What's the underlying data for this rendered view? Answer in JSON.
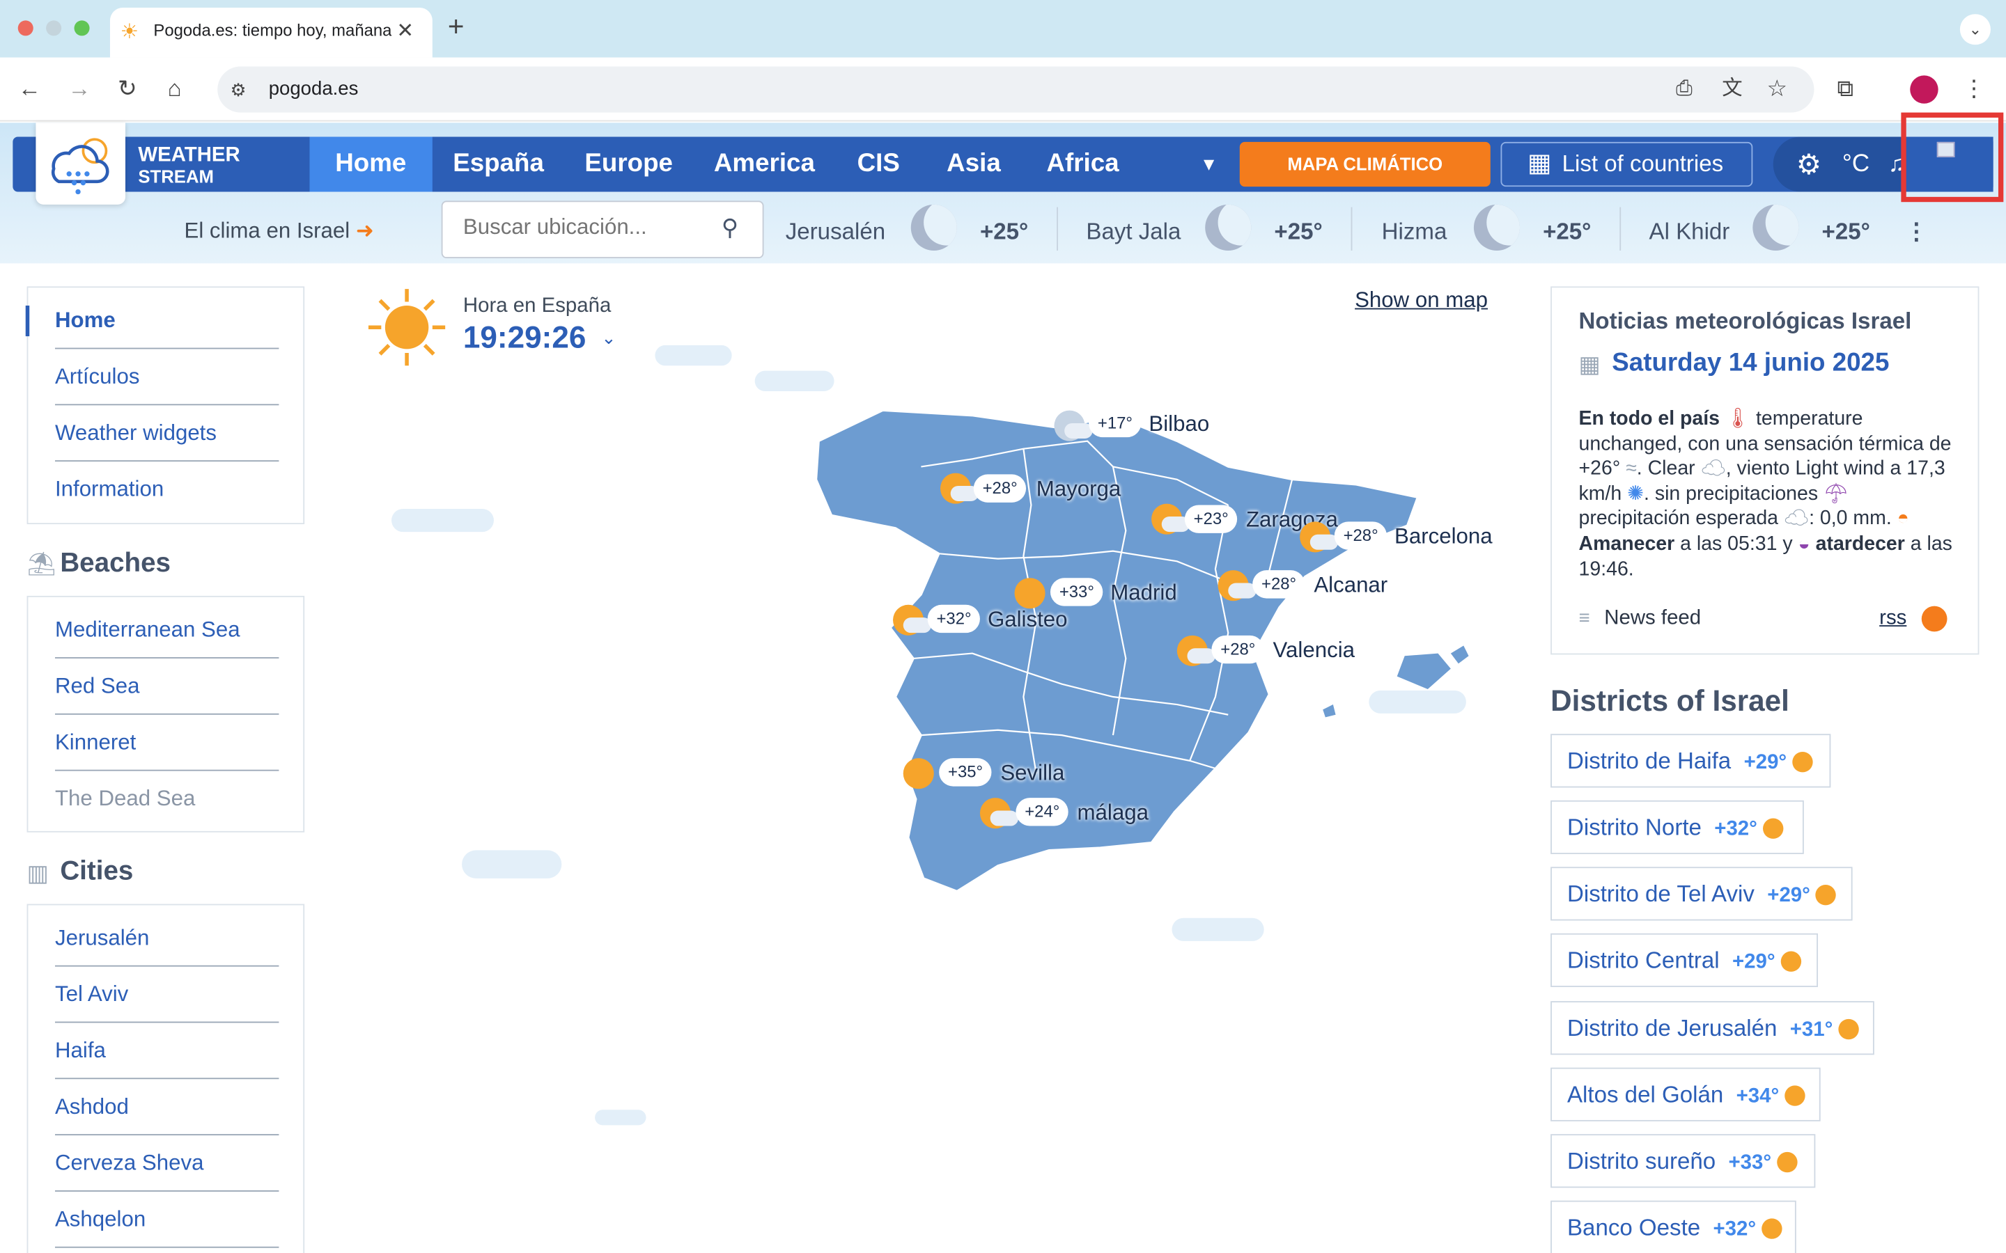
{
  "browser": {
    "tab_title": "Pogoda.es: tiempo hoy, mañana",
    "url": "pogoda.es"
  },
  "site": {
    "logo": {
      "line1": "WEATHER",
      "line2": "STREAM"
    },
    "nav": [
      {
        "label": "Home"
      },
      {
        "label": "España"
      },
      {
        "label": "Europe"
      },
      {
        "label": "America"
      },
      {
        "label": "CIS"
      },
      {
        "label": "Asia"
      },
      {
        "label": "Africa"
      }
    ],
    "mapa_btn": "MAPA CLIMÁTICO",
    "countries_btn": "List of countries",
    "unit": "°C",
    "climate_link": "El clima en Israel",
    "search_placeholder": "Buscar ubicación...",
    "top_cities": [
      {
        "name": "Jerusalén",
        "temp": "+25°"
      },
      {
        "name": "Bayt Jala",
        "temp": "+25°"
      },
      {
        "name": "Hizma",
        "temp": "+25°"
      },
      {
        "name": "Al Khidr",
        "temp": "+25°"
      }
    ]
  },
  "sidebar": {
    "menu": [
      "Home",
      "Artículos",
      "Weather widgets",
      "Information"
    ],
    "beaches_title": "Beaches",
    "beaches": [
      "Mediterranean Sea",
      "Red Sea",
      "Kinneret",
      "The Dead Sea"
    ],
    "cities_title": "Cities",
    "cities": [
      "Jerusalén",
      "Tel Aviv",
      "Haifa",
      "Ashdod",
      "Cerveza Sheva",
      "Ashqelon"
    ]
  },
  "center": {
    "time_label": "Hora en España",
    "time": "19:29:26",
    "show_on_map": "Show on map",
    "map_points": [
      {
        "city": "Bilbao",
        "temp": "+17°"
      },
      {
        "city": "Mayorga",
        "temp": "+28°"
      },
      {
        "city": "Zaragoza",
        "temp": "+23°"
      },
      {
        "city": "Barcelona",
        "temp": "+28°"
      },
      {
        "city": "Madrid",
        "temp": "+33°"
      },
      {
        "city": "Alcanar",
        "temp": "+28°"
      },
      {
        "city": "Galisteo",
        "temp": "+32°"
      },
      {
        "city": "Valencia",
        "temp": "+28°"
      },
      {
        "city": "Sevilla",
        "temp": "+35°"
      },
      {
        "city": "málaga",
        "temp": "+24°"
      }
    ]
  },
  "news": {
    "title": "Noticias meteorológicas Israel",
    "date": "Saturday 14 junio 2025",
    "lead": "En todo el país",
    "t1": " temperature unchanged, con una sensación térmica de +26°",
    "t2": ". Clear ",
    "t3": ", viento Light wind a 17,3 km/h ",
    "t4": ". sin precipitaciones ",
    "t5": " precipitación esperada ",
    "t6": ": 0,0 mm.",
    "amanecer": "Amanecer",
    "t7": " a las 05:31 y ",
    "atardecer": "atardecer",
    "t8": " a las 19:46.",
    "feed": "News feed",
    "rss": "rss"
  },
  "districts": {
    "title": "Districts of Israel",
    "items": [
      {
        "name": "Distrito de Haifa",
        "temp": "+29°"
      },
      {
        "name": "Distrito Norte",
        "temp": "+32°"
      },
      {
        "name": "Distrito de Tel Aviv",
        "temp": "+29°"
      },
      {
        "name": "Distrito Central",
        "temp": "+29°"
      },
      {
        "name": "Distrito de Jerusalén",
        "temp": "+31°"
      },
      {
        "name": "Altos del Golán",
        "temp": "+34°"
      },
      {
        "name": "Distrito sureño",
        "temp": "+33°"
      },
      {
        "name": "Banco Oeste",
        "temp": "+32°"
      }
    ]
  },
  "colors": {
    "brand": "#2c5eb6",
    "accent": "#f47c1c",
    "highlight": "#e53935"
  }
}
